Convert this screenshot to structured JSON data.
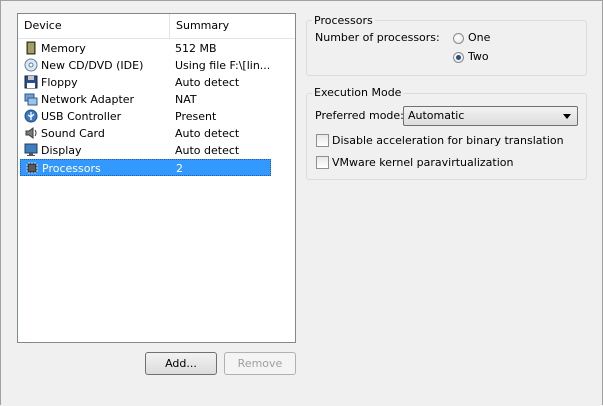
{
  "device_list": {
    "columns": {
      "device": "Device",
      "summary": "Summary"
    },
    "rows": [
      {
        "name": "Memory",
        "summary": "512 MB",
        "icon": "memory-icon",
        "selected": false
      },
      {
        "name": "New CD/DVD (IDE)",
        "summary": "Using file F:\\[lin...",
        "icon": "cd-dvd-icon",
        "selected": false
      },
      {
        "name": "Floppy",
        "summary": "Auto detect",
        "icon": "floppy-icon",
        "selected": false
      },
      {
        "name": "Network Adapter",
        "summary": "NAT",
        "icon": "network-adapter-icon",
        "selected": false
      },
      {
        "name": "USB Controller",
        "summary": "Present",
        "icon": "usb-icon",
        "selected": false
      },
      {
        "name": "Sound Card",
        "summary": "Auto detect",
        "icon": "sound-card-icon",
        "selected": false
      },
      {
        "name": "Display",
        "summary": "Auto detect",
        "icon": "display-icon",
        "selected": false
      },
      {
        "name": "Processors",
        "summary": "2",
        "icon": "processor-icon",
        "selected": true
      }
    ]
  },
  "buttons": {
    "add": "Add...",
    "remove": "Remove"
  },
  "processors": {
    "title": "Processors",
    "count_label": "Number of processors:",
    "options": [
      {
        "label": "One",
        "checked": false
      },
      {
        "label": "Two",
        "checked": true
      }
    ]
  },
  "execution_mode": {
    "title": "Execution Mode",
    "preferred_label": "Preferred mode:",
    "preferred_value": "Automatic",
    "checkboxes": [
      {
        "label": "Disable acceleration for binary translation",
        "checked": false
      },
      {
        "label": "VMware kernel paravirtualization",
        "checked": false
      }
    ]
  },
  "colors": {
    "selection": "#3399ff",
    "background": "#f0f0f0"
  }
}
